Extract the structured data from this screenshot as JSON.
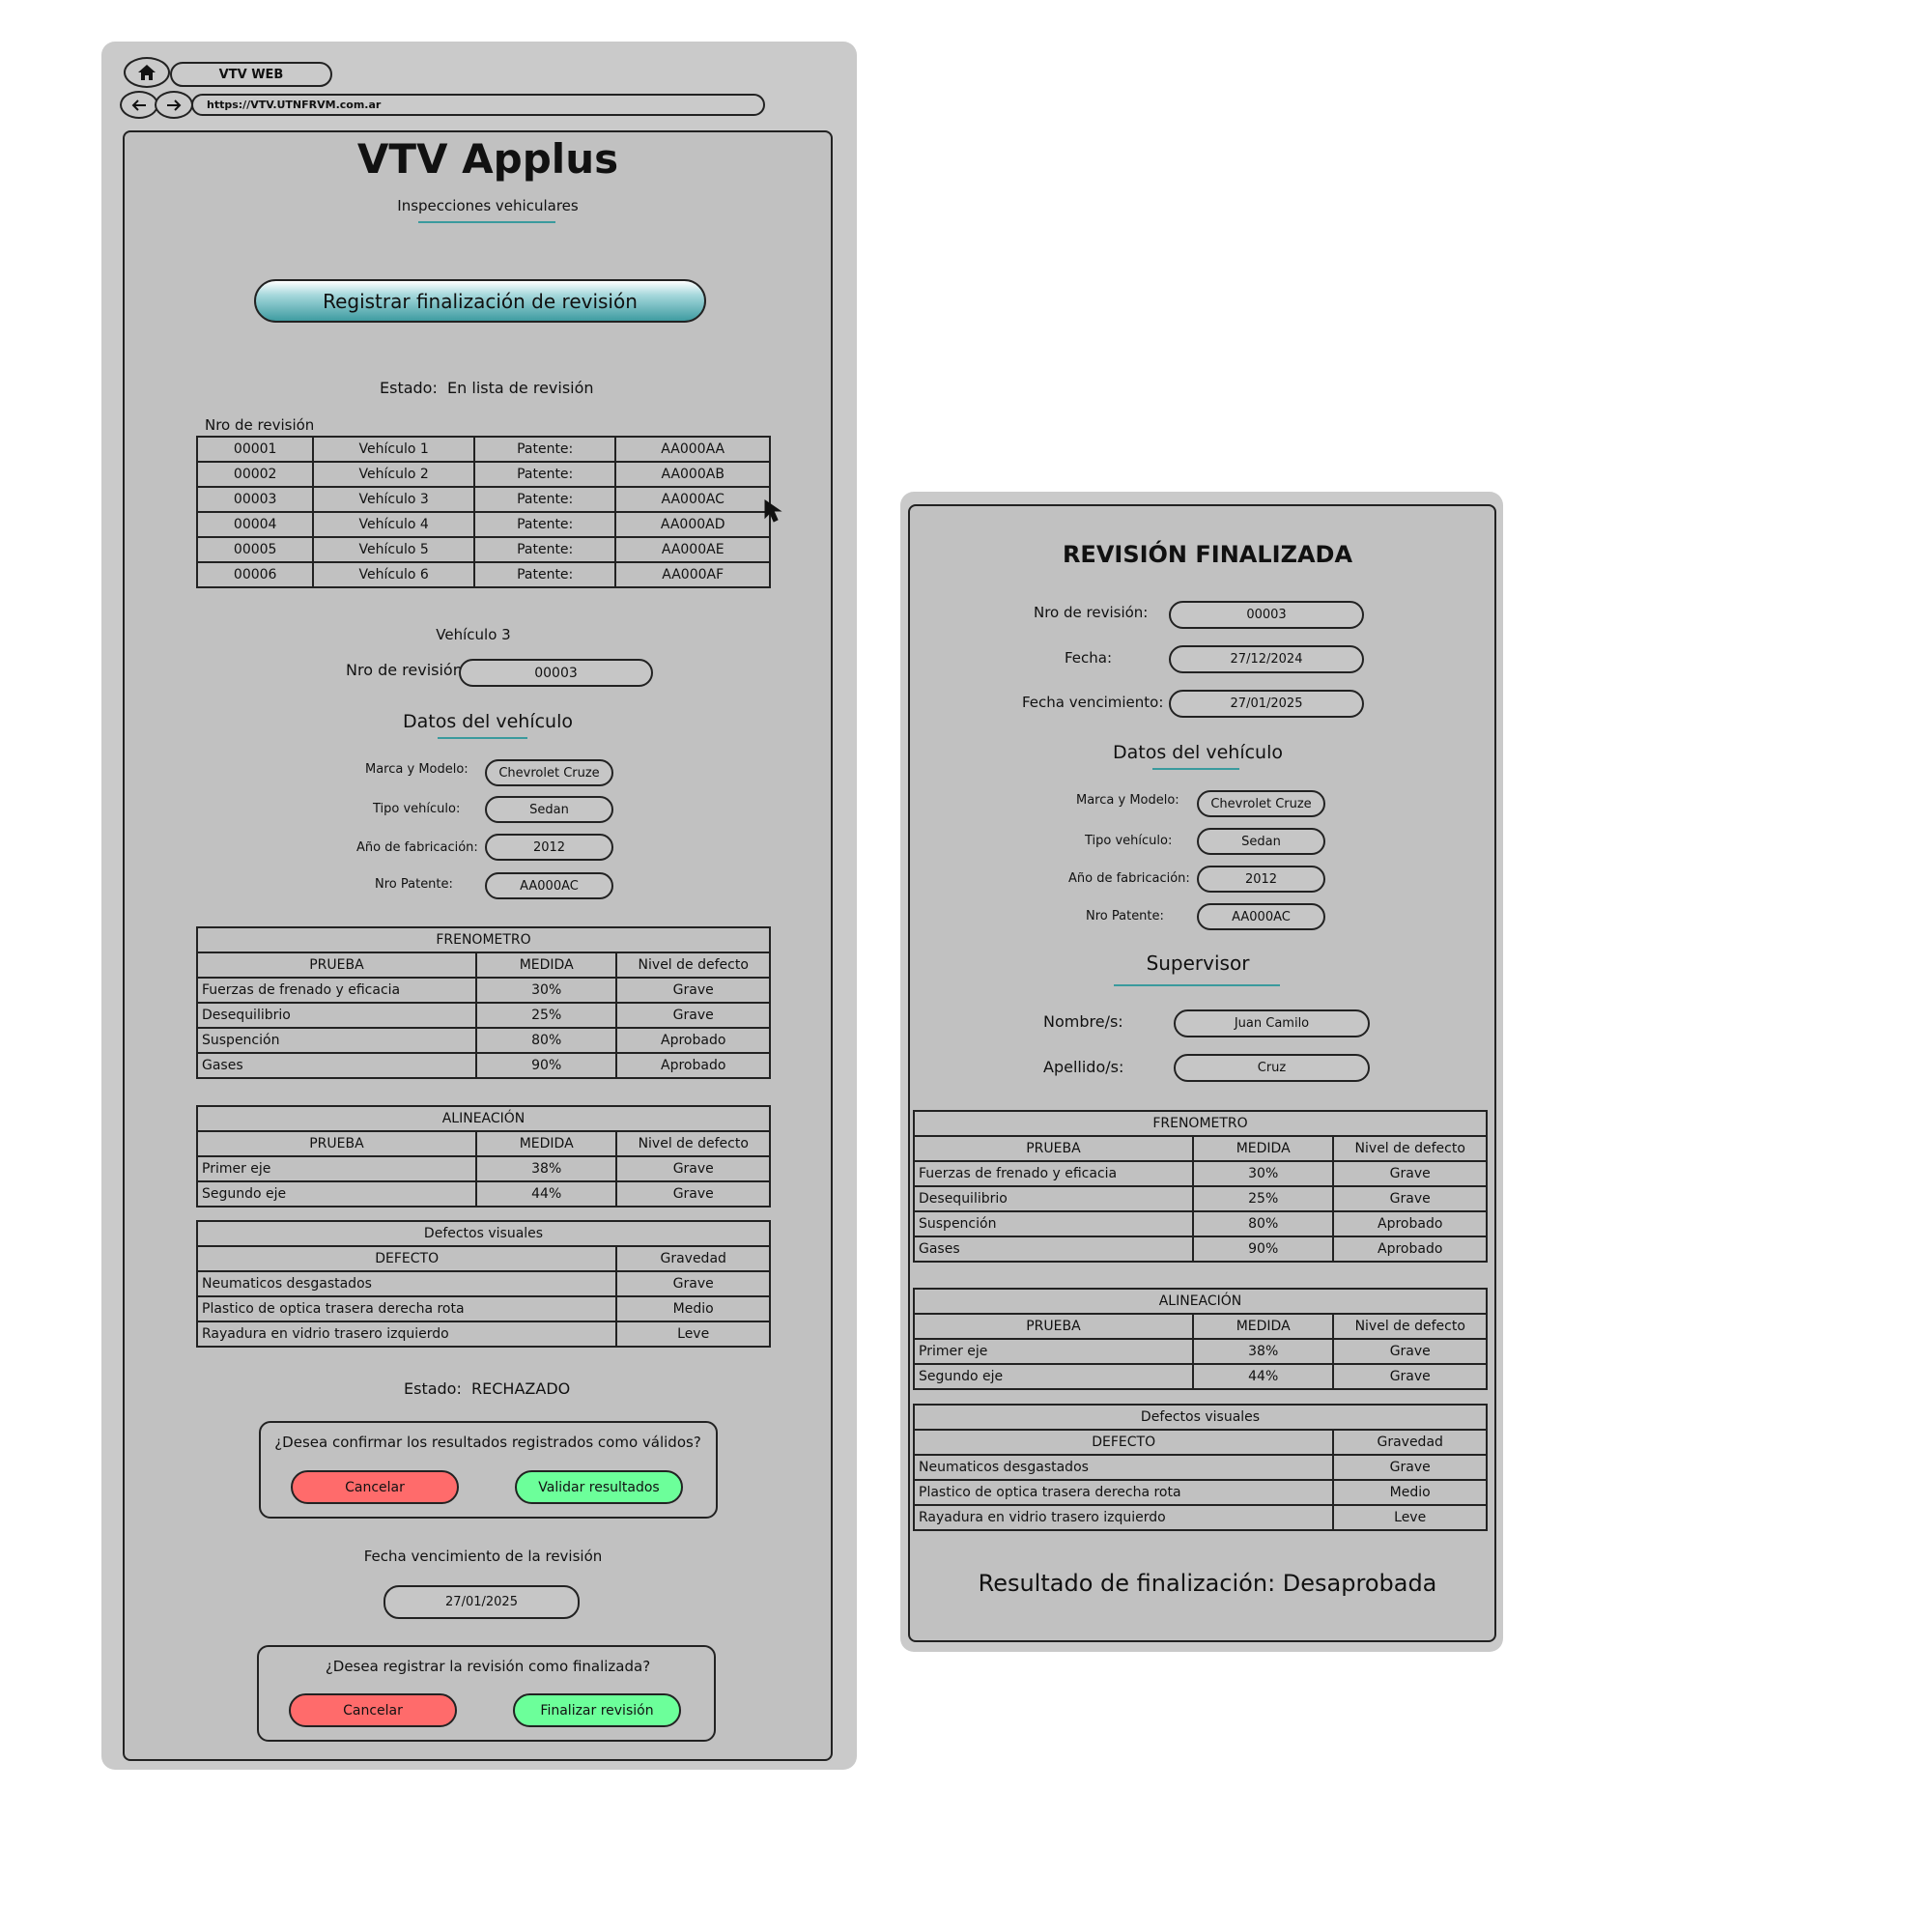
{
  "browser": {
    "tab_title": "VTV WEB",
    "url": "https://VTV.UTNFRVM.com.ar"
  },
  "page": {
    "title": "VTV Applus",
    "subtitle": "Inspecciones vehiculares",
    "main_button": "Registrar finalización de revisión",
    "estado_label": "Estado:",
    "estado_value": "En lista de revisión",
    "list_caption": "Nro de revisión",
    "revisions": [
      {
        "nro": "00001",
        "vehiculo": "Vehículo 1",
        "patente_label": "Patente:",
        "patente": "AA000AA"
      },
      {
        "nro": "00002",
        "vehiculo": "Vehículo 2",
        "patente_label": "Patente:",
        "patente": "AA000AB"
      },
      {
        "nro": "00003",
        "vehiculo": "Vehículo 3",
        "patente_label": "Patente:",
        "patente": "AA000AC"
      },
      {
        "nro": "00004",
        "vehiculo": "Vehículo 4",
        "patente_label": "Patente:",
        "patente": "AA000AD"
      },
      {
        "nro": "00005",
        "vehiculo": "Vehículo 5",
        "patente_label": "Patente:",
        "patente": "AA000AE"
      },
      {
        "nro": "00006",
        "vehiculo": "Vehículo 6",
        "patente_label": "Patente:",
        "patente": "AA000AF"
      }
    ],
    "selected_vehicle": "Vehículo 3",
    "nro_revision_label": "Nro de revisión:",
    "nro_revision_value": "00003",
    "datos_title": "Datos del vehículo",
    "marca_label": "Marca y Modelo:",
    "marca_value": "Chevrolet Cruze",
    "tipo_label": "Tipo vehículo:",
    "tipo_value": "Sedan",
    "anio_label": "Año de fabricación:",
    "anio_value": "2012",
    "patente_label": "Nro Patente:",
    "patente_value": "AA000AC",
    "frenometro": {
      "title": "FRENOMETRO",
      "headers": [
        "PRUEBA",
        "MEDIDA",
        "Nivel de defecto"
      ],
      "rows": [
        [
          "Fuerzas de frenado y eficacia",
          "30%",
          "Grave"
        ],
        [
          "Desequilibrio",
          "25%",
          "Grave"
        ],
        [
          "Suspención",
          "80%",
          "Aprobado"
        ],
        [
          "Gases",
          "90%",
          "Aprobado"
        ]
      ]
    },
    "alineacion": {
      "title": "ALINEACIÓN",
      "headers": [
        "PRUEBA",
        "MEDIDA",
        "Nivel de defecto"
      ],
      "rows": [
        [
          "Primer eje",
          "38%",
          "Grave"
        ],
        [
          "Segundo eje",
          "44%",
          "Grave"
        ]
      ]
    },
    "defectos": {
      "title": "Defectos visuales",
      "headers": [
        "DEFECTO",
        "Gravedad"
      ],
      "rows": [
        [
          "Neumaticos desgastados",
          "Grave"
        ],
        [
          "Plastico de optica trasera derecha rota",
          "Medio"
        ],
        [
          "Rayadura en vidrio trasero izquierdo",
          "Leve"
        ]
      ]
    },
    "estado2_label": "Estado:",
    "estado2_value": "RECHAZADO",
    "confirm_question": "¿Desea confirmar los resultados registrados como válidos?",
    "confirm_cancel": "Cancelar",
    "confirm_ok": "Validar resultados",
    "vencimiento_label": "Fecha vencimiento de la revisión",
    "vencimiento_value": "27/01/2025",
    "finalize_question": "¿Desea registrar la revisión como finalizada?",
    "finalize_cancel": "Cancelar",
    "finalize_ok": "Finalizar revisión"
  },
  "result_panel": {
    "title": "REVISIÓN FINALIZADA",
    "nro_label": "Nro de revisión:",
    "nro_value": "00003",
    "fecha_label": "Fecha:",
    "fecha_value": "27/12/2024",
    "venc_label": "Fecha vencimiento:",
    "venc_value": "27/01/2025",
    "datos_title": "Datos del vehículo",
    "marca_label": "Marca y Modelo:",
    "marca_value": "Chevrolet Cruze",
    "tipo_label": "Tipo vehículo:",
    "tipo_value": "Sedan",
    "anio_label": "Año de fabricación:",
    "anio_value": "2012",
    "patente_label": "Nro Patente:",
    "patente_value": "AA000AC",
    "supervisor_title": "Supervisor",
    "nombre_label": "Nombre/s:",
    "nombre_value": "Juan Camilo",
    "apellido_label": "Apellido/s:",
    "apellido_value": "Cruz",
    "resultado": "Resultado de finalización: Desaprobada"
  },
  "icons": {
    "home": "home-icon",
    "back": "arrow-left-icon",
    "forward": "arrow-right-icon",
    "cursor": "mouse-cursor-icon"
  },
  "colors": {
    "cancel": "#ff6b6b",
    "confirm": "#6cff9a",
    "accent": "#3f9ca1"
  }
}
